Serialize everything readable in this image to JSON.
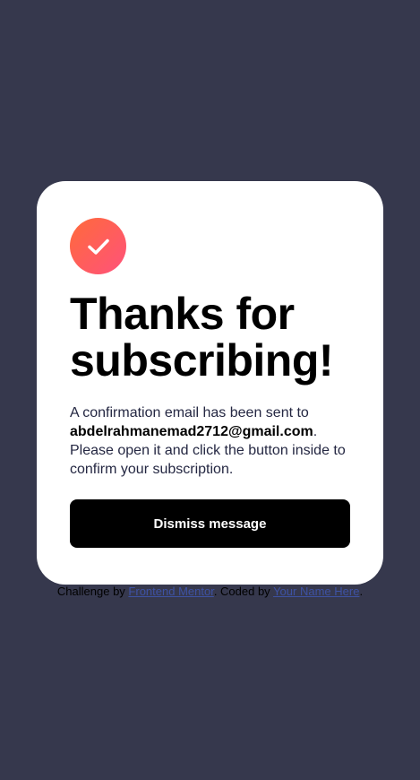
{
  "card": {
    "icon": "success-check-icon",
    "title": "Thanks for subscribing!",
    "message_before": "A confirmation email has been sent to",
    "email": "abdelrahmanemad2712@gmail.com",
    "message_after": ". Please open it and click the button inside to confirm your subscription.",
    "dismiss_label": "Dismiss message"
  },
  "attribution": {
    "prefix": "Challenge by ",
    "link1": "Frontend Mentor",
    "middle": ". Coded by ",
    "link2": "Your Name Here",
    "suffix": "."
  },
  "colors": {
    "background": "#36384d",
    "card": "#ffffff",
    "icon_gradient_start": "#ff6a3a",
    "icon_gradient_end": "#ff527b",
    "button": "#000000",
    "link": "#3e52a3"
  }
}
